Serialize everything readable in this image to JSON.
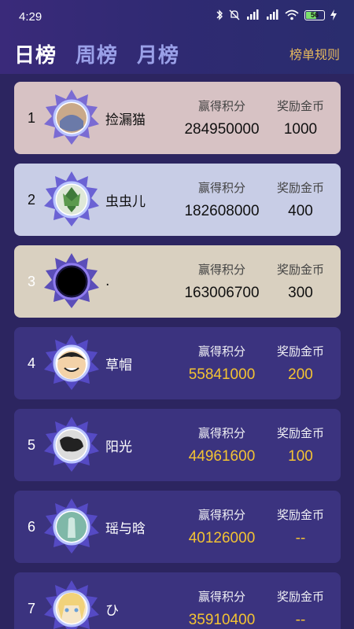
{
  "status_bar": {
    "time": "4:29",
    "battery": "56"
  },
  "tabs": [
    {
      "label": "日榜",
      "active": true
    },
    {
      "label": "周榜",
      "active": false
    },
    {
      "label": "月榜",
      "active": false
    }
  ],
  "rules_label": "榜单规则",
  "col_score_label": "赢得积分",
  "col_reward_label": "奖励金币",
  "entries": [
    {
      "rank": "1",
      "name": "捡漏猫",
      "score": "284950000",
      "reward": "1000"
    },
    {
      "rank": "2",
      "name": "虫虫儿",
      "score": "182608000",
      "reward": "400"
    },
    {
      "rank": "3",
      "name": ".",
      "score": "163006700",
      "reward": "300"
    },
    {
      "rank": "4",
      "name": "草帽",
      "score": "55841000",
      "reward": "200"
    },
    {
      "rank": "5",
      "name": "阳光",
      "score": "44961600",
      "reward": "100"
    },
    {
      "rank": "6",
      "name": "瑶与晗",
      "score": "40126000",
      "reward": "--"
    },
    {
      "rank": "7",
      "name": "ひ",
      "score": "35910400",
      "reward": "--"
    }
  ],
  "colors": {
    "gold_value": "#f3c333",
    "rules_link": "#e6b95c",
    "card_rank1": "#d7c2c4",
    "card_rank2": "#c8cde6",
    "card_rank3": "#d9d0c0",
    "card_default": "#3b337f"
  }
}
